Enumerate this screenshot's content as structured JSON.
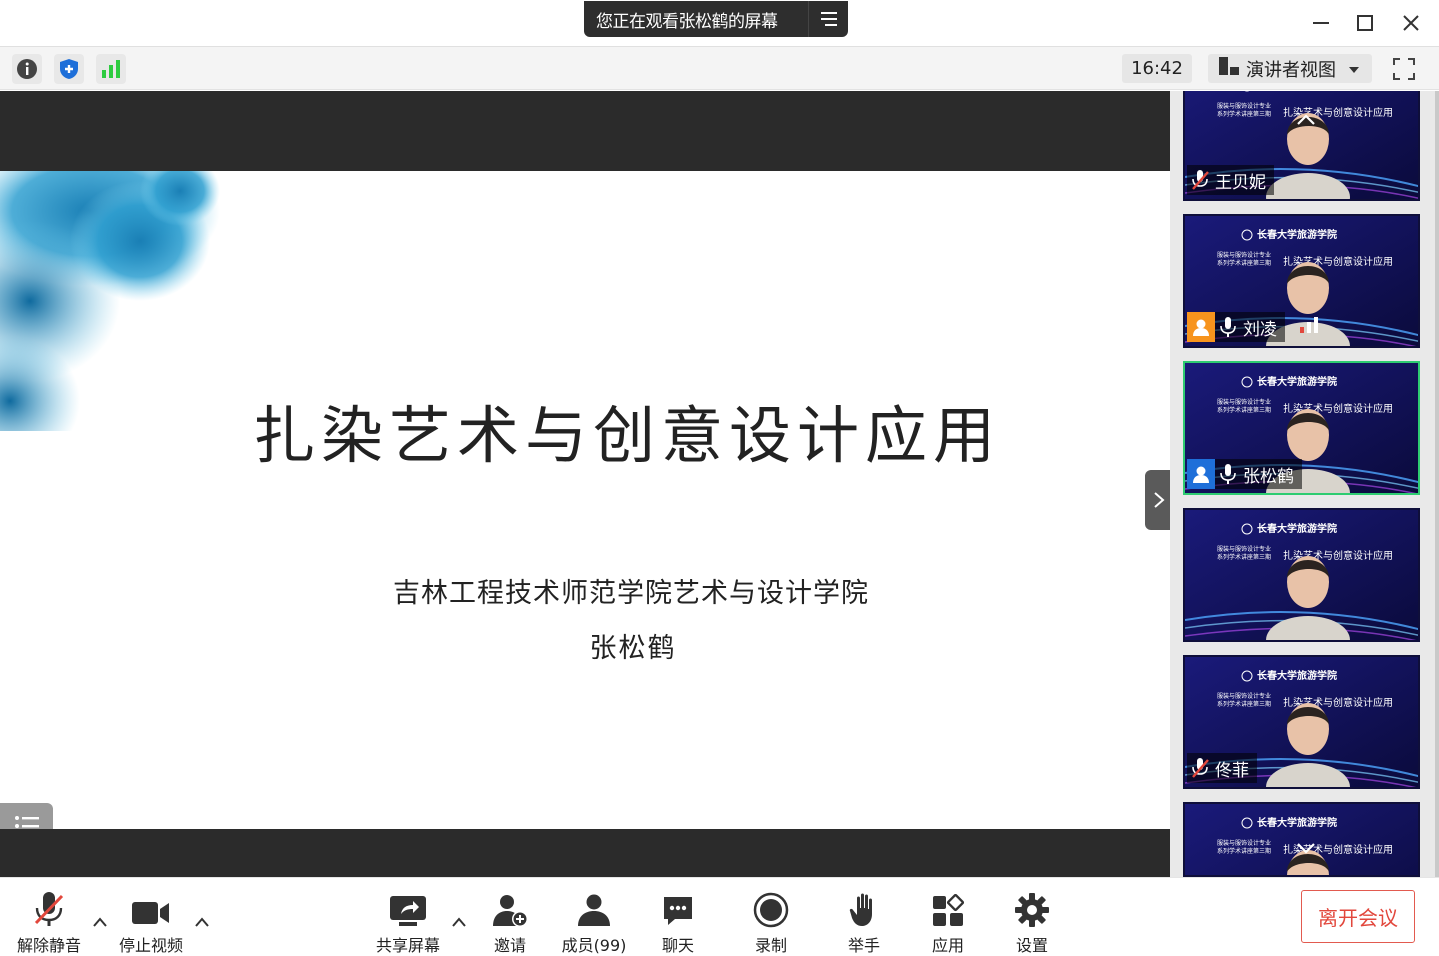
{
  "window": {
    "sharing_notice": "您正在观看张松鹤的屏幕"
  },
  "infobar": {
    "clock": "16:42",
    "view_mode": "演讲者视图"
  },
  "slide": {
    "title": "扎染艺术与创意设计应用",
    "subtitle": "吉林工程技术师范学院艺术与设计学院",
    "author": "张松鹤"
  },
  "participants": [
    {
      "name": "王贝妮",
      "muted": true,
      "avatar_color": "",
      "speaking": false
    },
    {
      "name": "刘凌",
      "muted": false,
      "avatar_color": "#f7941d",
      "speaking": false
    },
    {
      "name": "张松鹤",
      "muted": false,
      "avatar_color": "#1e6fd9",
      "speaking": true
    },
    {
      "name": "",
      "muted": false,
      "avatar_color": "",
      "speaking": false
    },
    {
      "name": "佟菲",
      "muted": true,
      "avatar_color": "",
      "speaking": false
    },
    {
      "name": "",
      "muted": false,
      "avatar_color": "",
      "speaking": false
    }
  ],
  "tile_banner": {
    "school": "长春大学旅游学院",
    "program_line1": "服装与服饰设计专业",
    "program_line2": "系列学术讲座第三期",
    "topic": "扎染艺术与创意设计应用"
  },
  "toolbar": {
    "unmute": "解除静音",
    "stop_video": "停止视频",
    "share_screen": "共享屏幕",
    "invite": "邀请",
    "members": "成员(99)",
    "chat": "聊天",
    "record": "录制",
    "raise_hand": "举手",
    "apps": "应用",
    "settings": "设置",
    "leave": "离开会议"
  },
  "colors": {
    "accent_blue": "#1e6fd9",
    "leave_red": "#e2473c",
    "signal_green": "#2ecc40",
    "tile_bg": "#15145a"
  }
}
